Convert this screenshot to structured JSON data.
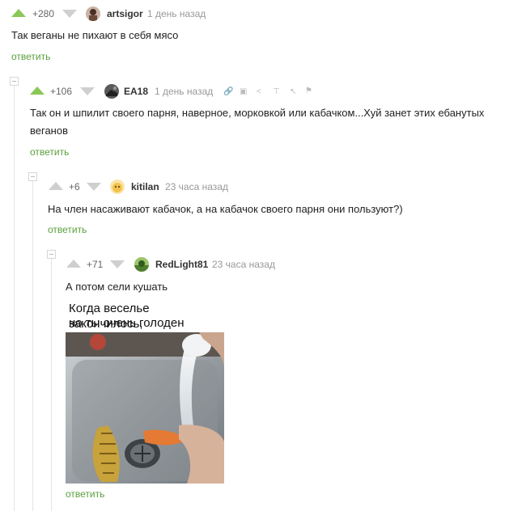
{
  "comments": [
    {
      "rating": "+280",
      "user": "artsigor",
      "time": "1 день назад",
      "text": "Так веганы не пихают в себя мясо",
      "reply": "ответить"
    },
    {
      "rating": "+106",
      "user": "EA18",
      "time": "1 день назад",
      "text": "Так он и шпилит своего парня, наверное, морковкой или кабачком...Хуй занет этих ебанутых веганов",
      "reply": "ответить",
      "tools": [
        "link-icon",
        "save-icon",
        "share-icon",
        "pin-icon",
        "cursor-icon",
        "flag-icon"
      ]
    },
    {
      "rating": "+6",
      "user": "kitilan",
      "time": "23 часа назад",
      "text": "На член насаживают кабачок, а на кабачок своего парня они пользуют?)",
      "reply": "ответить"
    },
    {
      "rating": "+71",
      "user": "RedLight81",
      "time": "23 часа назад",
      "text": "А потом сели кушать",
      "image_caption": [
        "Когда веселье закончилось,",
        "но ты очень голоден"
      ],
      "reply": "ответить"
    }
  ],
  "colors": {
    "accent": "#5aa03b",
    "upvote": "#8ac858",
    "thread_line": "#e4e4e4"
  }
}
